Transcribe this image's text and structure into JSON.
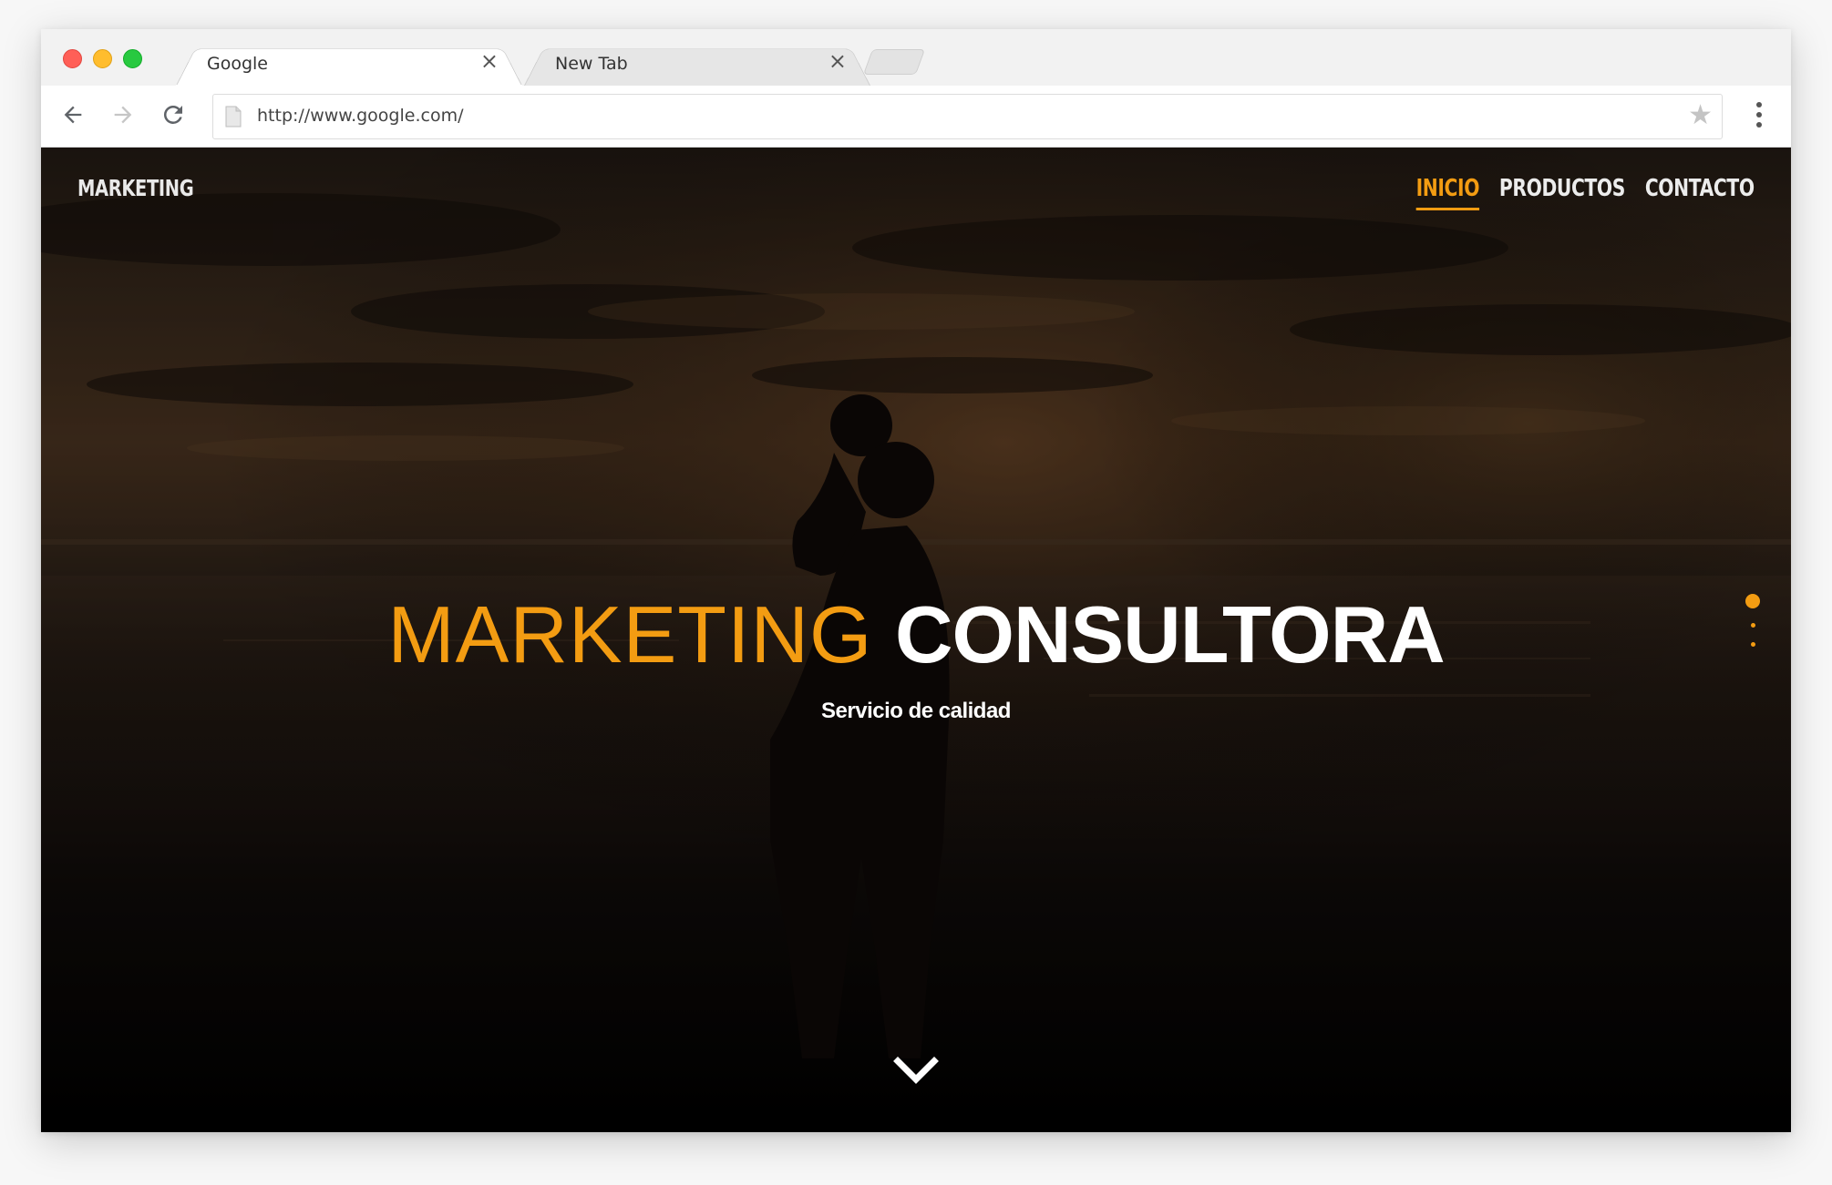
{
  "browser": {
    "tabs": [
      {
        "title": "Google",
        "close_glyph": "×",
        "active": true
      },
      {
        "title": "New Tab",
        "close_glyph": "×",
        "active": false
      }
    ],
    "url": "http://www.google.com/",
    "icons": {
      "back": "arrow-left-icon",
      "forward": "arrow-right-icon",
      "reload": "reload-icon",
      "page": "page-icon",
      "bookmark": "star-icon",
      "menu": "more-vertical-icon"
    },
    "star_glyph": "★"
  },
  "site": {
    "brand": "MARKETING",
    "nav": [
      {
        "label": "INICIO",
        "active": true
      },
      {
        "label": "PRODUCTOS",
        "active": false
      },
      {
        "label": "CONTACTO",
        "active": false
      }
    ],
    "headline_light": "MARKETING",
    "headline_bold": "CONSULTORA",
    "subheadline": "Servicio de calidad",
    "slide_dots": {
      "count": 3,
      "active_index": 0
    },
    "scroll_icon": "chevron-down-icon"
  },
  "colors": {
    "accent": "#f39c12",
    "text_light": "#ffffff",
    "nav_text": "#ececec"
  }
}
